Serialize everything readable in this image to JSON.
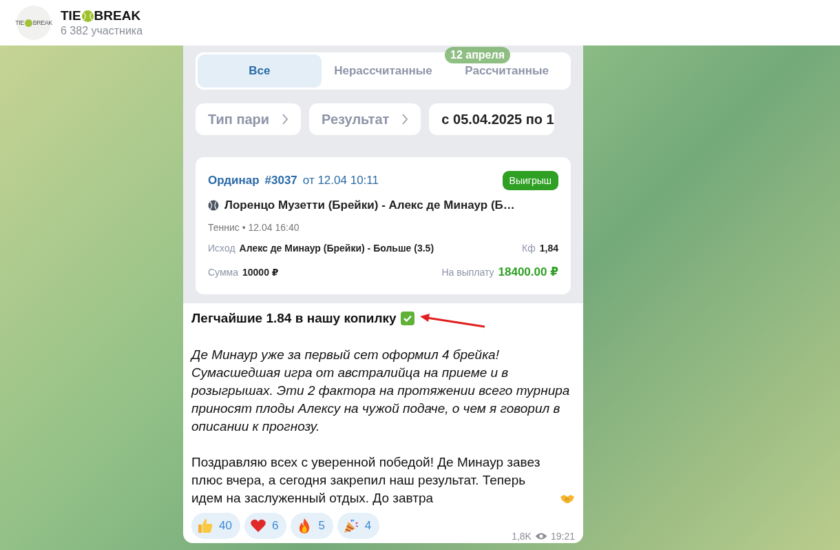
{
  "header": {
    "avatar": {
      "left": "TIE",
      "right": "BREAK"
    },
    "title_left": "TIE",
    "title_right": "BREAK",
    "subtitle": "6 382 участника"
  },
  "date_pill": "12 апреля",
  "screenshot": {
    "tabs": [
      {
        "label": "Все",
        "selected": true
      },
      {
        "label": "Нерассчитанные",
        "selected": false
      },
      {
        "label": "Рассчитанные",
        "selected": false
      }
    ],
    "filters": [
      {
        "label": "Тип пари",
        "kind": "select"
      },
      {
        "label": "Результат",
        "kind": "select"
      },
      {
        "label": "с 05.04.2025 по 1",
        "kind": "date"
      }
    ],
    "bet": {
      "type": "Ординар",
      "number": "#3037",
      "date": "от 12.04 10:11",
      "status": "Выигрыш",
      "event": "Лоренцо Музетти (Брейки) - Алекс де Минаур (Б…",
      "sport": "Теннис • 12.04 16:40",
      "outcome_label": "Исход",
      "outcome": "Алекс де Минаур (Брейки) - Больше (3.5)",
      "odds_label": "Кф",
      "odds": "1,84",
      "amount_label": "Сумма",
      "amount": "10000 ₽",
      "payout_label": "На выплату",
      "payout": "18400.00 ₽"
    }
  },
  "message": {
    "headline": "Легчайшие 1.84 в нашу копилку",
    "paragraph_1": "Де Минаур уже за первый сет оформил 4 брейка!\nСумасшедшая игра от австралийца на приеме и в розыгрышах. Эти 2 фактора на протяжении всего турнира приносят плоды Алексу на чужой подаче, о чем я говорил в описании к прогнозу.",
    "paragraph_2": "Поздравляю всех с уверенной победой! Де Минаур завез плюс вчера, а сегодня закрепил наш результат. Теперь идем на заслуженный отдых. До завтра"
  },
  "reactions": [
    {
      "kind": "thumbs",
      "count": "40"
    },
    {
      "kind": "heart",
      "count": "6"
    },
    {
      "kind": "fire",
      "count": "5"
    },
    {
      "kind": "party",
      "count": "4"
    }
  ],
  "views": "1,8K",
  "time": "19:21"
}
